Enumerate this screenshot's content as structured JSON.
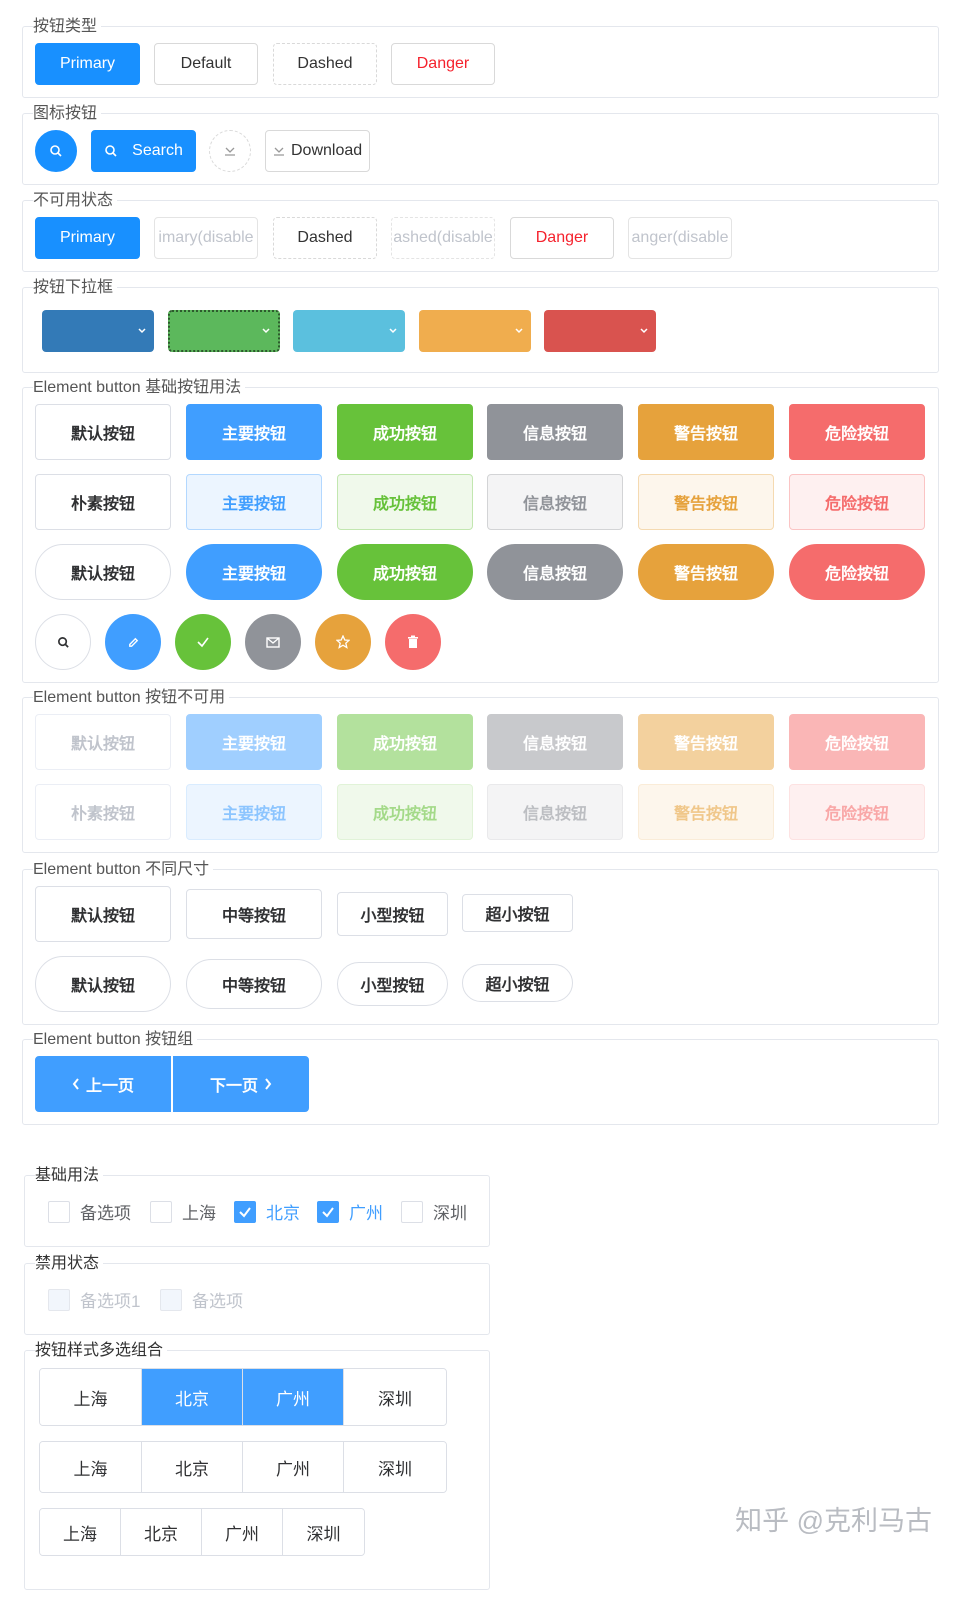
{
  "sections": {
    "button_types": "按钮类型",
    "icon_buttons": "图标按钮",
    "disabled_state": "不可用状态",
    "dropdown_buttons": "按钮下拉框",
    "element_basic": "Element button 基础按钮用法",
    "element_disabled": "Element button 按钮不可用",
    "element_sizes": "Element button 不同尺寸",
    "element_group": "Element button 按钮组",
    "checkbox_basic": "基础用法",
    "checkbox_disabled": "禁用状态",
    "checkbox_button_group": "按钮样式多选组合"
  },
  "button_types": {
    "primary": "Primary",
    "default": "Default",
    "dashed": "Dashed",
    "danger": "Danger"
  },
  "icon_buttons": {
    "search": "Search",
    "download": "Download"
  },
  "disabled_state": {
    "primary": "Primary",
    "primary_disabled": "imary(disable",
    "dashed": "Dashed",
    "dashed_disabled": "ashed(disable",
    "danger": "Danger",
    "danger_disabled": "anger(disable"
  },
  "element_basic": {
    "default": "默认按钮",
    "plain": "朴素按钮",
    "primary": "主要按钮",
    "success": "成功按钮",
    "info": "信息按钮",
    "warning": "警告按钮",
    "danger": "危险按钮"
  },
  "element_disabled": {
    "default": "默认按钮",
    "plain": "朴素按钮",
    "primary": "主要按钮",
    "success": "成功按钮",
    "info": "信息按钮",
    "warning": "警告按钮",
    "danger": "危险按钮"
  },
  "element_sizes": {
    "default": "默认按钮",
    "medium": "中等按钮",
    "small": "小型按钮",
    "mini": "超小按钮"
  },
  "element_group": {
    "prev": "上一页",
    "next": "下一页"
  },
  "checkbox_basic": [
    "备选项",
    "上海",
    "北京",
    "广州",
    "深圳"
  ],
  "checkbox_disabled": [
    "备选项1",
    "备选项"
  ],
  "checkbox_buttons": {
    "row1": [
      "上海",
      "北京",
      "广州",
      "深圳"
    ],
    "row2": [
      "上海",
      "北京",
      "广州",
      "深圳"
    ],
    "row3": [
      "上海",
      "北京",
      "广州",
      "深圳"
    ]
  },
  "watermark": "知乎 @克利马古",
  "colors": {
    "antd_primary": "#1890ff",
    "el_primary": "#409eff",
    "el_success": "#67c23a",
    "el_info": "#909399",
    "el_warning": "#e6a23c",
    "el_danger": "#f56c6c",
    "dropdown_blue": "#337ab7",
    "dropdown_green": "#5cb85c",
    "dropdown_cyan": "#5bc0de",
    "dropdown_orange": "#f0ad4e",
    "dropdown_red": "#d9534f"
  }
}
